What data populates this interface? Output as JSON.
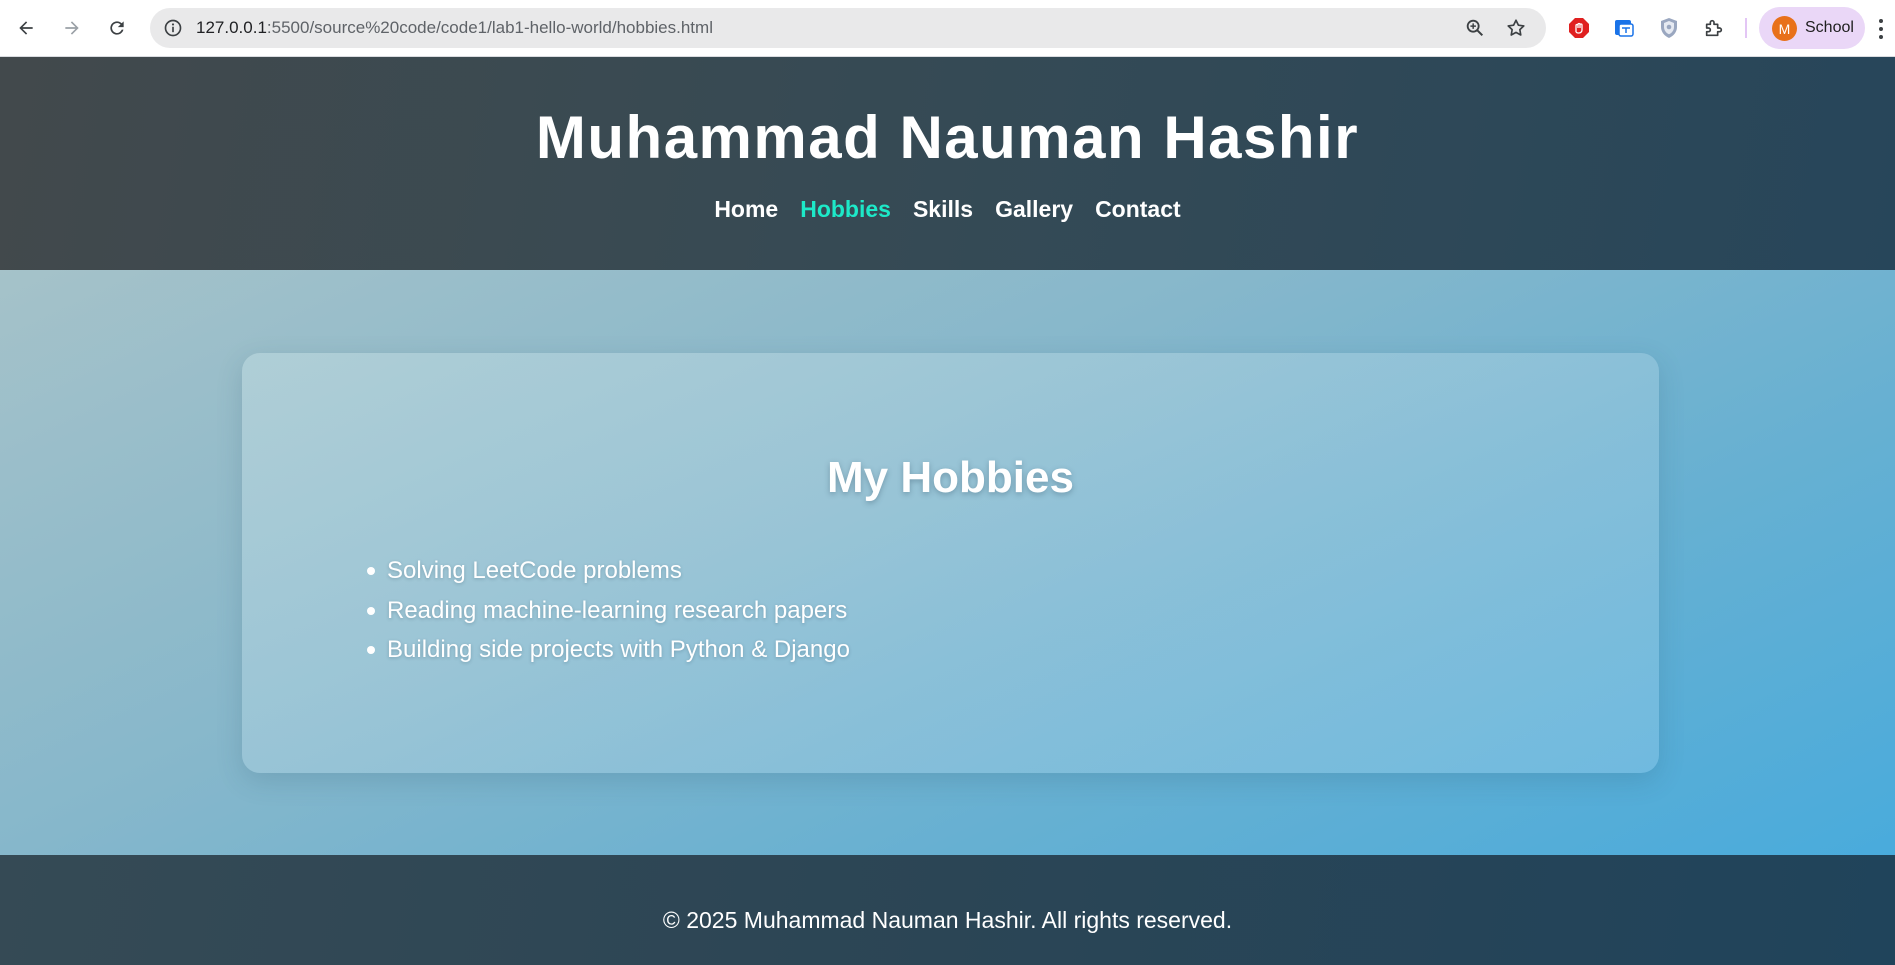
{
  "browser": {
    "url_host": "127.0.0.1",
    "url_rest": ":5500/source%20code/code1/lab1-hello-world/hobbies.html",
    "profile_initial": "M",
    "profile_name": "School",
    "icons": [
      "back-arrow-icon",
      "forward-arrow-icon",
      "reload-icon",
      "site-info-icon",
      "zoom-icon",
      "bookmark-star-icon",
      "adblock-extension-icon",
      "translate-extension-icon",
      "shield-extension-icon",
      "extensions-puzzle-icon",
      "more-menu-icon"
    ]
  },
  "header": {
    "title": "Muhammad Nauman Hashir",
    "nav": [
      {
        "label": "Home",
        "active": false
      },
      {
        "label": "Hobbies",
        "active": true
      },
      {
        "label": "Skills",
        "active": false
      },
      {
        "label": "Gallery",
        "active": false
      },
      {
        "label": "Contact",
        "active": false
      }
    ]
  },
  "main": {
    "heading": "My Hobbies",
    "hobbies": [
      "Solving LeetCode problems",
      "Reading machine-learning research papers",
      "Building side projects with Python & Django"
    ]
  },
  "footer": {
    "text": "© 2025 Muhammad Nauman Hashir. All rights reserved."
  },
  "colors": {
    "active_nav": "#1de9c8",
    "header_bg": "#354a55",
    "accent_blue": "#49abdc"
  }
}
